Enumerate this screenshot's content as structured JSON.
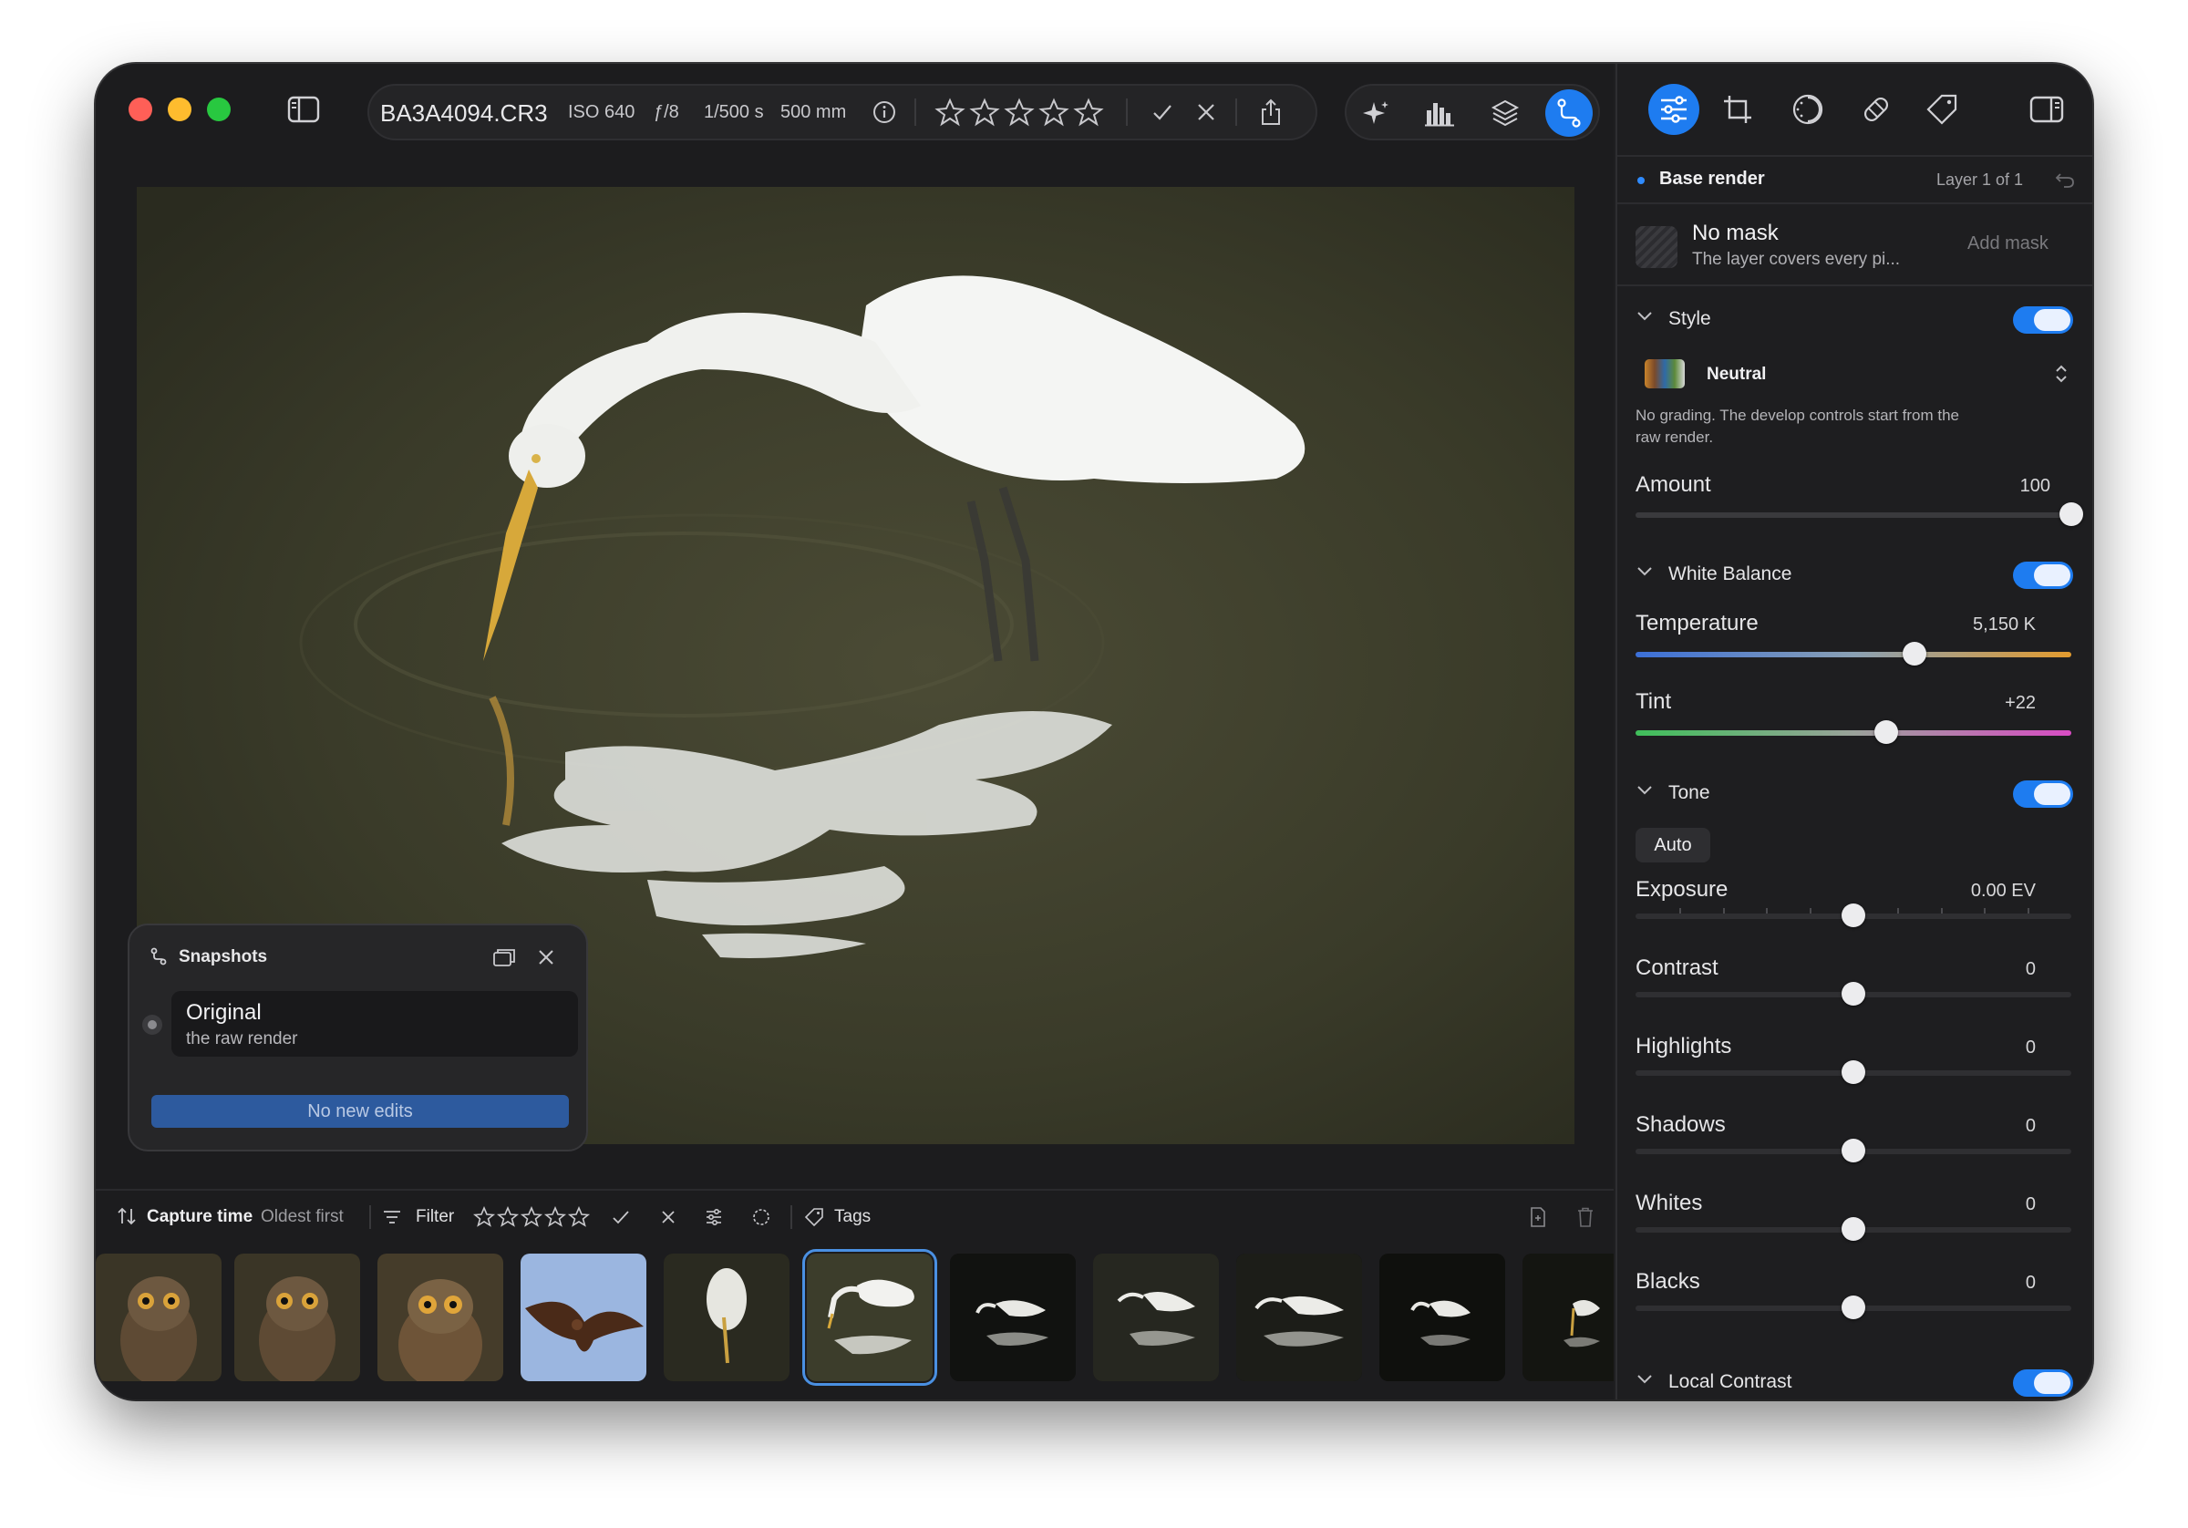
{
  "toolbar": {
    "filename": "BA3A4094.CR3",
    "iso": "ISO 640",
    "aperture": "ƒ/8",
    "shutter": "1/500 s",
    "focal": "500 mm"
  },
  "colors": {
    "accent": "#1e7cf0",
    "close": "#ff5f57",
    "minimize": "#febc2e",
    "zoom": "#28c840",
    "no_edits_button": "#2d5a9e"
  },
  "snapshots": {
    "title": "Snapshots",
    "item_name": "Original",
    "item_desc": "the raw render",
    "button": "No new edits"
  },
  "filterbar": {
    "sort_label": "Capture time",
    "sort_order": "Oldest first",
    "filter_label": "Filter",
    "tags_label": "Tags"
  },
  "thumbnails": [
    "owl",
    "owl",
    "owl",
    "kite",
    "egret",
    "egret",
    "egret",
    "egret",
    "egret",
    "egret",
    "egret"
  ],
  "right_panel": {
    "layer_name": "Base render",
    "layer_count": "Layer 1 of 1",
    "mask_title": "No mask",
    "mask_desc": "The layer covers every pi...",
    "add_mask": "Add mask",
    "style": {
      "title": "Style",
      "preset": "Neutral",
      "desc_line1": "No grading. The develop controls start from the",
      "desc_line2": "raw render.",
      "amount_label": "Amount",
      "amount_value": "100",
      "amount_fraction": 1.0
    },
    "white_balance": {
      "title": "White Balance",
      "temperature_label": "Temperature",
      "temperature_value": "5,150 K",
      "temperature_fraction": 0.64,
      "tint_label": "Tint",
      "tint_value": "+22",
      "tint_fraction": 0.575
    },
    "tone": {
      "title": "Tone",
      "auto": "Auto",
      "rows": [
        {
          "label": "Exposure",
          "value": "0.00 EV",
          "fraction": 0.5
        },
        {
          "label": "Contrast",
          "value": "0",
          "fraction": 0.5
        },
        {
          "label": "Highlights",
          "value": "0",
          "fraction": 0.5
        },
        {
          "label": "Shadows",
          "value": "0",
          "fraction": 0.5
        },
        {
          "label": "Whites",
          "value": "0",
          "fraction": 0.5
        },
        {
          "label": "Blacks",
          "value": "0",
          "fraction": 0.5
        }
      ]
    },
    "local_contrast": {
      "title": "Local Contrast"
    }
  }
}
